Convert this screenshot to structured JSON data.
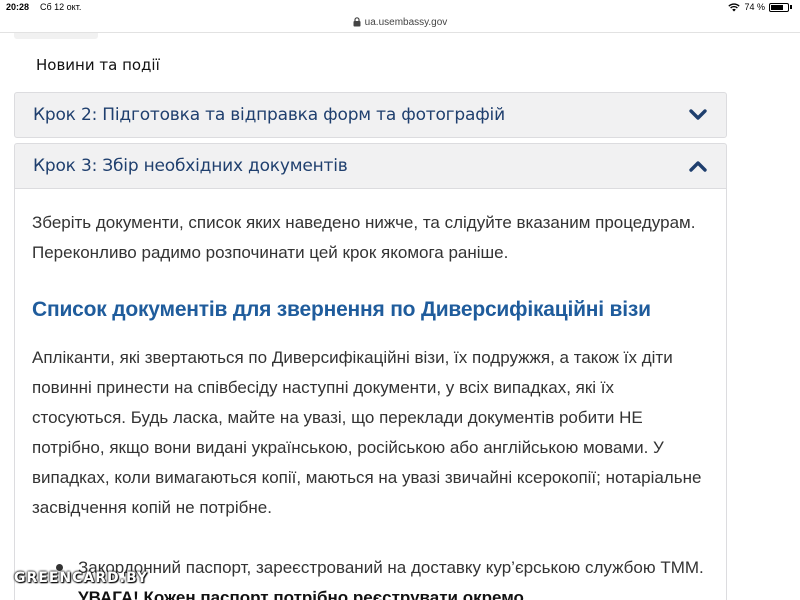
{
  "status_bar": {
    "time": "20:28",
    "date": "Сб 12 окт.",
    "battery_text": "74 %",
    "battery_level": 0.74
  },
  "browser": {
    "url": "ua.usembassy.gov",
    "lock_icon": "lock-icon"
  },
  "nav": {
    "news_link": "Новини та події"
  },
  "accordions": [
    {
      "step": "Крок",
      "num": "2",
      "title": ": Підготовка та відправка форм та фотографій",
      "state": "collapsed",
      "icon": "chevron-down-icon"
    },
    {
      "step": "Крок",
      "num": "3",
      "title": ": Збір необхідних документів",
      "state": "expanded",
      "icon": "chevron-up-icon"
    }
  ],
  "content": {
    "intro": "Зберіть документи, список яких наведено нижче, та слідуйте вказаним процедурам. Переконливо радимо розпочинати цей крок якомога раніше.",
    "section_title": "Список документів для звернення по Диверсифікаційні візи",
    "body": "Апліканти, які звертаються по Диверсифікаційні візи, їх подружжя, а також їх діти повинні принести на співбесіду наступні документи, у всіх випадках, які їх стосуються. Будь ласка, майте на увазі, що переклади документів робити НЕ потрібно, якщо вони  видані українською, російською або англійською мовами. У випадках, коли вимагаються копії, маються на увазі звичайні ксерокопії; нотаріальне засвідчення копій не потрібне.",
    "bullets": [
      {
        "text": "Закордонний паспорт, зареєстрований на доставку кур’єрською службою ТММ. ",
        "strong": "УВАГА! Кожен паспорт потрібно реєструвати окремо"
      }
    ]
  },
  "watermark": "GREENCARD.BY",
  "colors": {
    "accordion_title": "#1f3f6e",
    "section_title": "#1f5c9c",
    "accordion_bg": "#f1f1f2",
    "text": "#333333"
  }
}
